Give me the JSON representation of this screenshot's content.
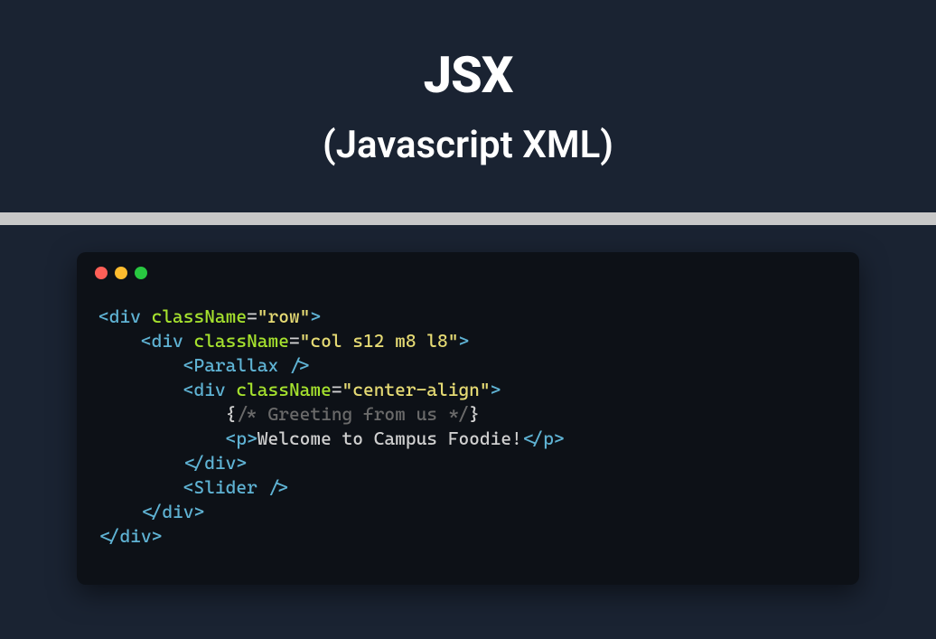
{
  "header": {
    "title": "JSX",
    "subtitle": "(Javascript XML)"
  },
  "window": {
    "dot_red": "#ff5f57",
    "dot_yellow": "#febc2e",
    "dot_green": "#28c840"
  },
  "code": {
    "line1": {
      "tag": "div",
      "attr": "className",
      "val": "\"row\""
    },
    "line2": {
      "tag": "div",
      "attr": "className",
      "val": "\"col s12 m8 l8\""
    },
    "line3": {
      "tag": "Parallax"
    },
    "line4": {
      "tag": "div",
      "attr": "className",
      "val": "\"center-align\""
    },
    "line5": {
      "open": "{",
      "comment": "/* Greeting from us */",
      "close": "}"
    },
    "line6": {
      "tag": "p",
      "text": "Welcome to Campus Foodie!",
      "endtag": "p"
    },
    "line7": {
      "tag": "div"
    },
    "line8": {
      "tag": "Slider"
    },
    "line9": {
      "tag": "div"
    },
    "line10": {
      "tag": "div"
    }
  }
}
